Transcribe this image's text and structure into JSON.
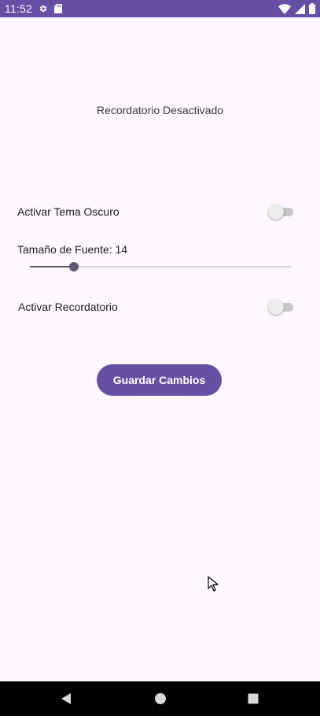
{
  "status_bar": {
    "time": "11:52",
    "background": "#6750a4",
    "left_icons": [
      "gear-icon",
      "sd-card-icon"
    ],
    "right_icons": [
      "wifi-icon",
      "signal-icon",
      "battery-icon"
    ]
  },
  "reminder_status_text": "Recordatorio Desactivado",
  "settings": {
    "dark_theme": {
      "label": "Activar Tema Oscuro",
      "enabled": false
    },
    "font_size": {
      "label": "Tamaño de Fuente: 14",
      "value": 14,
      "fraction": 0.17
    },
    "reminder": {
      "label": "Activar Recordatorio",
      "enabled": false
    }
  },
  "save_button_label": "Guardar Cambios",
  "colors": {
    "accent": "#6750a4",
    "background": "#fef7fd",
    "slider": "#625b71"
  },
  "nav_bar": {
    "buttons": [
      "back-icon",
      "home-icon",
      "recents-icon"
    ]
  }
}
